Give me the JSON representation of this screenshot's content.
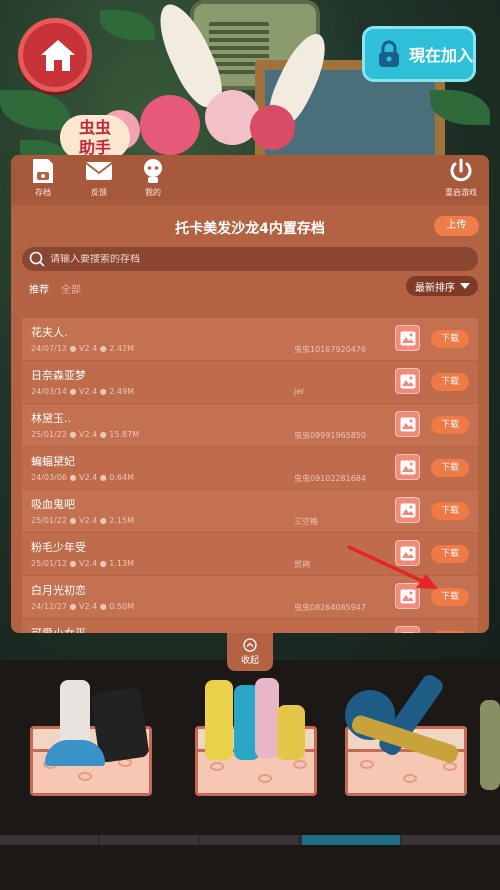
{
  "header": {
    "join_label": "現在加入",
    "sign_text": "虫虫\n助手"
  },
  "toolbar": {
    "save_label": "存档",
    "feedback_label": "反馈",
    "mine_label": "我的",
    "restart_label": "重启游戏"
  },
  "panel": {
    "title": "托卡美发沙龙4内置存档",
    "upload_label": "上传",
    "search_placeholder": "请输入要搜索的存档",
    "tabs": [
      {
        "label": "推荐",
        "active": true
      },
      {
        "label": "全部",
        "active": false
      }
    ],
    "sort_label": "最新排序",
    "download_label": "下载",
    "collapse_label": "收起"
  },
  "saves": [
    {
      "name": "花夫人.",
      "date": "24/07/12",
      "version": "V2.4",
      "size": "2.42M",
      "uploader": "虫虫10167920476"
    },
    {
      "name": "日奈森亚梦",
      "date": "24/03/14",
      "version": "V2.4",
      "size": "2.49M",
      "uploader": "jer"
    },
    {
      "name": "林黛玉..",
      "date": "25/01/22",
      "version": "V2.4",
      "size": "15.87M",
      "uploader": "虫虫09991965850"
    },
    {
      "name": "蝙蝠黛妃",
      "date": "24/03/06",
      "version": "V2.4",
      "size": "0.64M",
      "uploader": "虫虫09102281684"
    },
    {
      "name": "吸血鬼吧",
      "date": "25/01/22",
      "version": "V2.4",
      "size": "2.15M",
      "uploader": "三空格"
    },
    {
      "name": "粉毛少年受",
      "date": "25/01/12",
      "version": "V2.4",
      "size": "1.13M",
      "uploader": "贺鸽"
    },
    {
      "name": "白月光初恋",
      "date": "24/12/27",
      "version": "V2.4",
      "size": "0.50M",
      "uploader": "虫虫08264085947"
    },
    {
      "name": "可爱小女巫",
      "date": "",
      "version": "",
      "size": "",
      "uploader": ""
    }
  ],
  "colors": {
    "panel": "#b36343",
    "accent_button": "#f07a45",
    "home_button": "#c8333a",
    "join_button": "#2ec0d8",
    "arrow": "#e8242a"
  }
}
